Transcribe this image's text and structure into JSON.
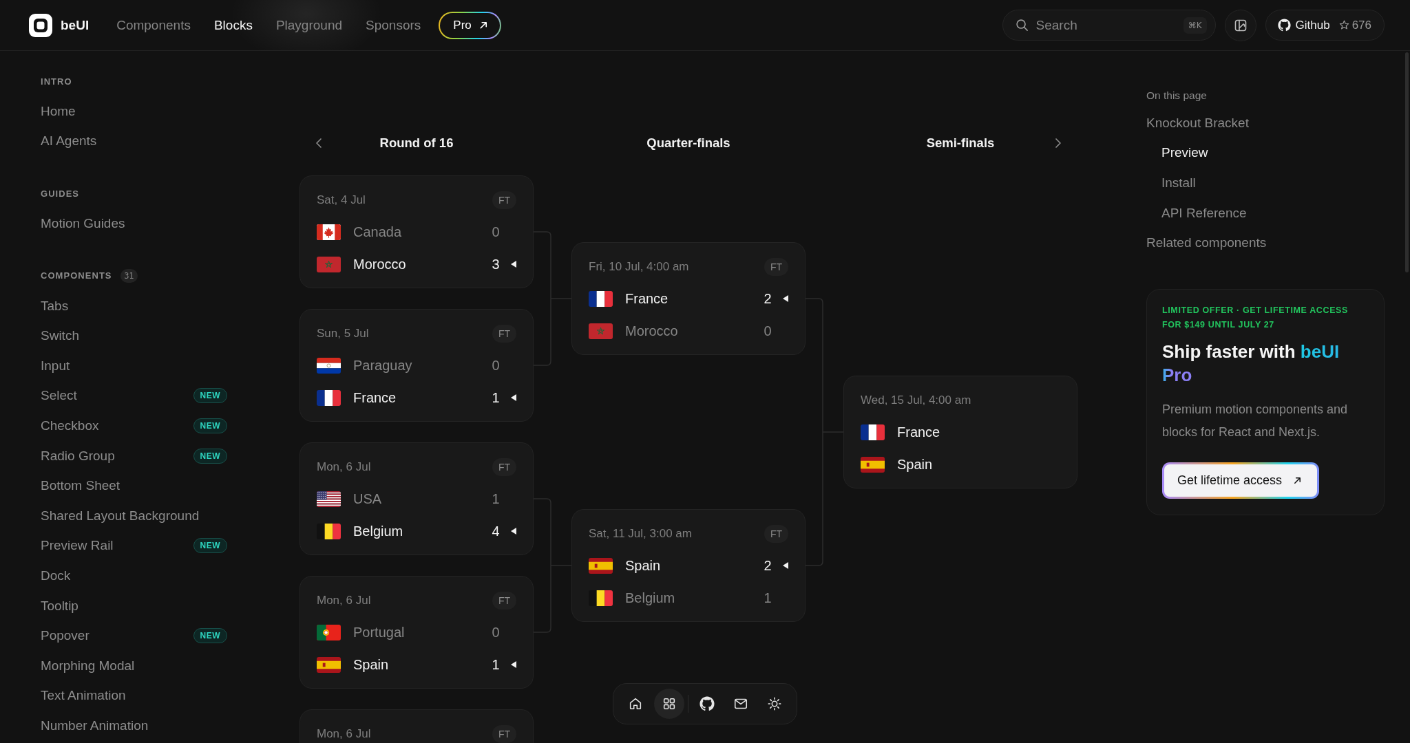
{
  "header": {
    "logo": "beUI",
    "nav": [
      {
        "label": "Components",
        "selected": false
      },
      {
        "label": "Blocks",
        "selected": true
      },
      {
        "label": "Playground",
        "selected": false
      },
      {
        "label": "Sponsors",
        "selected": false
      }
    ],
    "pro_button": "Pro",
    "search": {
      "placeholder": "Search",
      "shortcut": "⌘K"
    },
    "github": {
      "label": "Github",
      "star_count": "676"
    }
  },
  "sidebar": {
    "sections": [
      {
        "title": "INTRO",
        "items": [
          {
            "label": "Home"
          },
          {
            "label": "AI Agents"
          }
        ]
      },
      {
        "title": "GUIDES",
        "items": [
          {
            "label": "Motion Guides"
          }
        ]
      },
      {
        "title": "COMPONENTS",
        "count": "31",
        "items": [
          {
            "label": "Tabs"
          },
          {
            "label": "Switch"
          },
          {
            "label": "Input"
          },
          {
            "label": "Select",
            "badge": "NEW"
          },
          {
            "label": "Checkbox",
            "badge": "NEW"
          },
          {
            "label": "Radio Group",
            "badge": "NEW"
          },
          {
            "label": "Bottom Sheet"
          },
          {
            "label": "Shared Layout Background"
          },
          {
            "label": "Preview Rail",
            "badge": "NEW"
          },
          {
            "label": "Dock"
          },
          {
            "label": "Tooltip"
          },
          {
            "label": "Popover",
            "badge": "NEW"
          },
          {
            "label": "Morphing Modal"
          },
          {
            "label": "Text Animation"
          },
          {
            "label": "Number Animation"
          }
        ]
      }
    ]
  },
  "bracket": {
    "rounds": [
      {
        "title": "Round of 16",
        "matches": [
          {
            "date": "Sat, 4 Jul",
            "status": "FT",
            "teams": [
              {
                "kind": "ca",
                "name": "Canada",
                "score": "0",
                "winner": false,
                "eliminated": true
              },
              {
                "kind": "ma",
                "name": "Morocco",
                "score": "3",
                "winner": true,
                "eliminated": false
              }
            ]
          },
          {
            "date": "Sun, 5 Jul",
            "status": "FT",
            "teams": [
              {
                "kind": "py",
                "name": "Paraguay",
                "score": "0",
                "winner": false,
                "eliminated": true
              },
              {
                "kind": "fr",
                "name": "France",
                "score": "1",
                "winner": true,
                "eliminated": false
              }
            ]
          },
          {
            "date": "Mon, 6 Jul",
            "status": "FT",
            "teams": [
              {
                "kind": "us",
                "name": "USA",
                "score": "1",
                "winner": false,
                "eliminated": true
              },
              {
                "kind": "be",
                "name": "Belgium",
                "score": "4",
                "winner": true,
                "eliminated": false
              }
            ]
          },
          {
            "date": "Mon, 6 Jul",
            "status": "FT",
            "teams": [
              {
                "kind": "pt",
                "name": "Portugal",
                "score": "0",
                "winner": false,
                "eliminated": true
              },
              {
                "kind": "es",
                "name": "Spain",
                "score": "1",
                "winner": true,
                "eliminated": false
              }
            ]
          },
          {
            "date": "Mon, 6 Jul",
            "status": "FT"
          }
        ]
      },
      {
        "title": "Quarter-finals",
        "matches": [
          {
            "date": "Fri, 10 Jul, 4:00 am",
            "status": "FT",
            "teams": [
              {
                "kind": "fr",
                "name": "France",
                "score": "2",
                "winner": true,
                "eliminated": false
              },
              {
                "kind": "ma",
                "name": "Morocco",
                "score": "0",
                "winner": false,
                "eliminated": true
              }
            ]
          },
          {
            "date": "Sat, 11 Jul, 3:00 am",
            "status": "FT",
            "teams": [
              {
                "kind": "es",
                "name": "Spain",
                "score": "2",
                "winner": true,
                "eliminated": false
              },
              {
                "kind": "be",
                "name": "Belgium",
                "score": "1",
                "winner": false,
                "eliminated": true
              }
            ]
          }
        ]
      },
      {
        "title": "Semi-finals",
        "matches": [
          {
            "date": "Wed, 15 Jul, 4:00 am",
            "teams": [
              {
                "kind": "fr",
                "name": "France",
                "winner": false,
                "eliminated": false
              },
              {
                "kind": "es",
                "name": "Spain",
                "winner": false,
                "eliminated": false
              }
            ]
          }
        ]
      }
    ]
  },
  "toc": {
    "title": "On this page",
    "items": [
      {
        "label": "Knockout Bracket",
        "selected": false,
        "children": [
          {
            "label": "Preview",
            "selected": true
          },
          {
            "label": "Install",
            "selected": false
          },
          {
            "label": "API Reference",
            "selected": false
          }
        ]
      },
      {
        "label": "Related components",
        "selected": false
      }
    ]
  },
  "promo": {
    "eyebrow": "LIMITED OFFER · GET LIFETIME ACCESS FOR $149 UNTIL JULY 27",
    "heading": "Ship faster with",
    "highlight": "beUI Pro",
    "body": "Premium motion components and blocks for React and Next.js.",
    "button": "Get lifetime access"
  },
  "dock": {
    "items": [
      {
        "kind": "home",
        "selected": false
      },
      {
        "kind": "grid",
        "selected": true
      },
      {
        "kind": "separator"
      },
      {
        "kind": "github",
        "selected": false
      },
      {
        "kind": "mail",
        "selected": false
      },
      {
        "kind": "theme",
        "selected": false
      }
    ]
  }
}
